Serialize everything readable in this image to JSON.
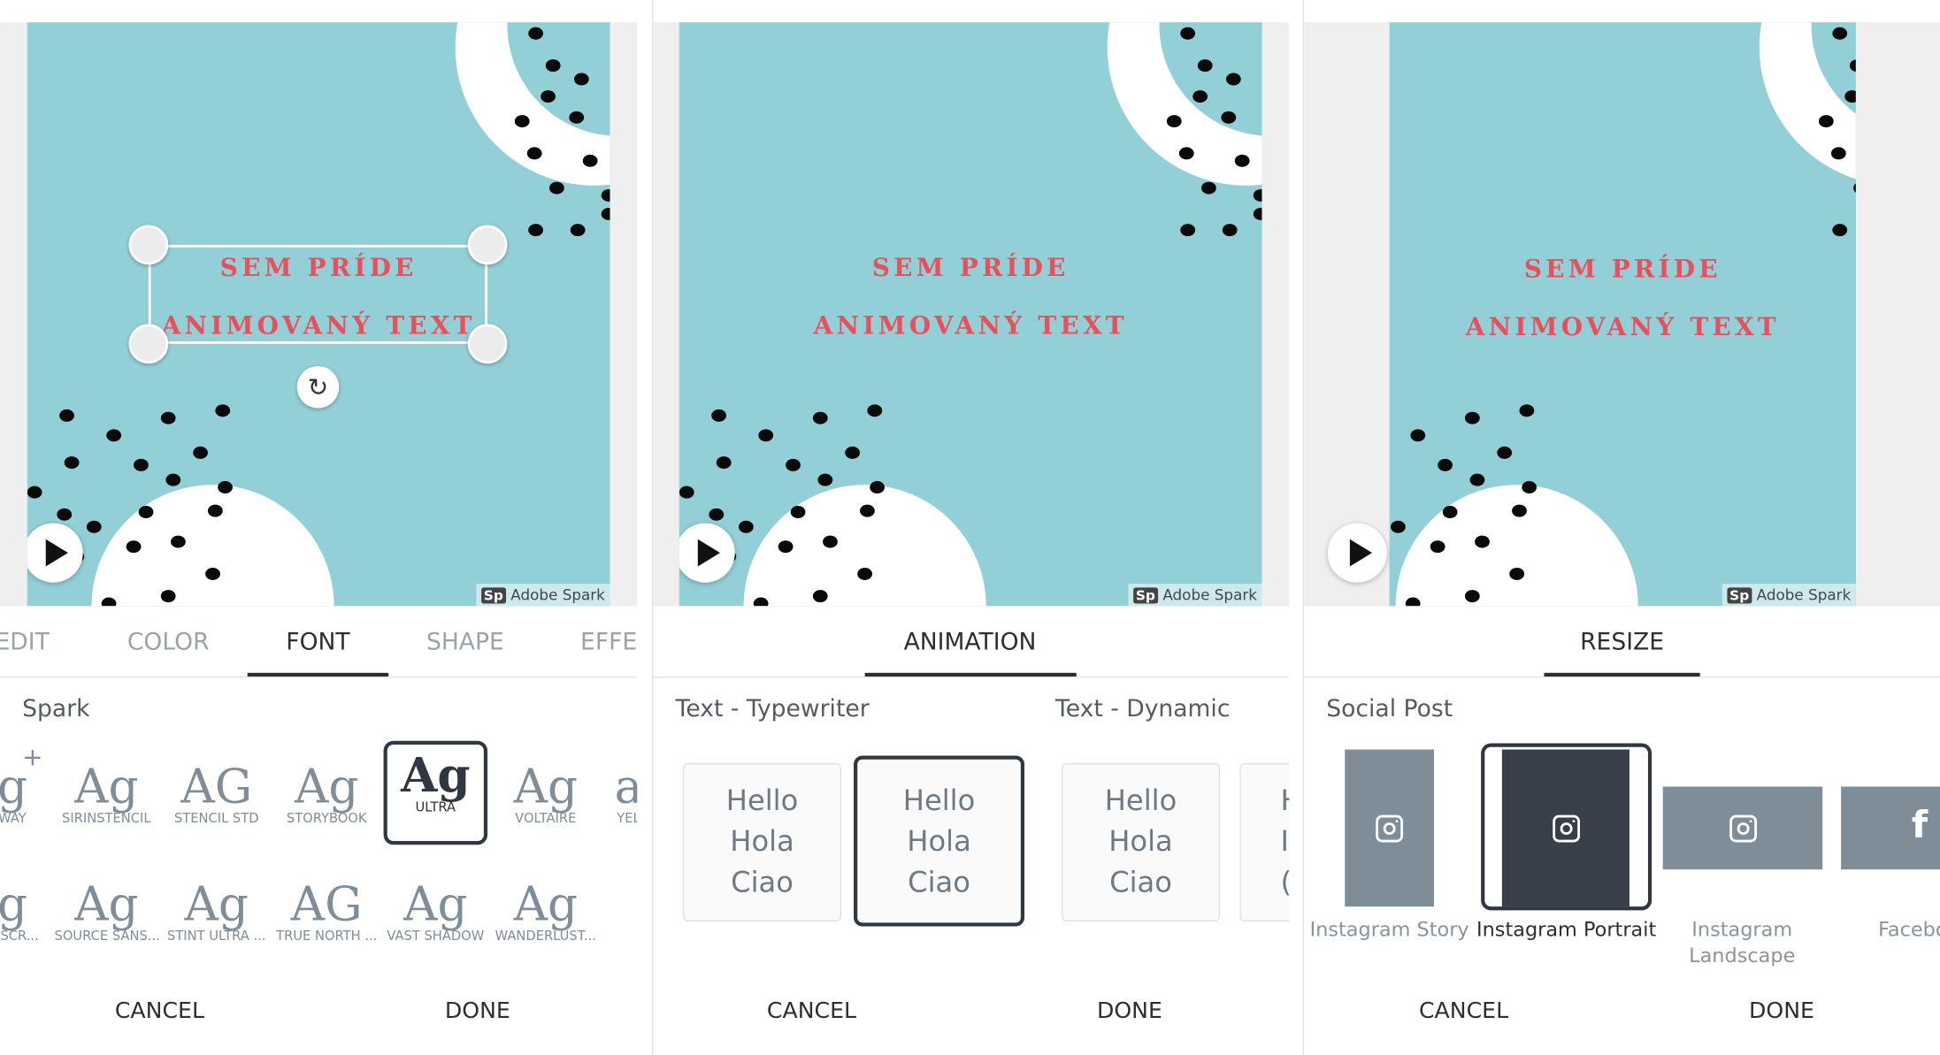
{
  "colors": {
    "canvas_bg": "#92cfd6",
    "text_red": "#e8505b",
    "selected": "#2f3740",
    "thumb_gray": "#7f8d99"
  },
  "design": {
    "line1": "SEM PRÍDE",
    "line2": "ANIMOVANÝ TEXT",
    "watermark_badge": "Sp",
    "watermark": "Adobe Spark",
    "play_icon": "play-icon",
    "rotate_icon": "rotate-icon"
  },
  "font_panel": {
    "tabs": [
      {
        "label": "EDIT"
      },
      {
        "label": "COLOR"
      },
      {
        "label": "FONT",
        "active": true
      },
      {
        "label": "SHAPE"
      },
      {
        "label": "EFFE"
      }
    ],
    "section": "Spark",
    "add_icon": "+",
    "row1": [
      {
        "glyph": "g",
        "label": "WAY"
      },
      {
        "glyph": "Ag",
        "label": "SIRINSTENCIL"
      },
      {
        "glyph": "AG",
        "label": "STENCIL STD"
      },
      {
        "glyph": "Ag",
        "label": "STORYBOOK"
      },
      {
        "glyph": "Ag",
        "label": "ULTRA",
        "selected": true
      },
      {
        "glyph": "Ag",
        "label": "VOLTAIRE"
      },
      {
        "glyph": "a",
        "label": "YEL"
      }
    ],
    "row2": [
      {
        "glyph": "g",
        "label": "O SCR..."
      },
      {
        "glyph": "Ag",
        "label": "SOURCE SANS..."
      },
      {
        "glyph": "Ag",
        "label": "STINT ULTRA ..."
      },
      {
        "glyph": "AG",
        "label": "TRUE NORTH ..."
      },
      {
        "glyph": "Ag",
        "label": "VAST SHADOW"
      },
      {
        "glyph": "Ag",
        "label": "WANDERLUST..."
      }
    ],
    "cancel": "CANCEL",
    "done": "DONE"
  },
  "animation_panel": {
    "tab": "ANIMATION",
    "sections": [
      "Text - Typewriter",
      "Text - Dynamic"
    ],
    "card_lines": [
      "Hello",
      "Hola",
      "Ciao"
    ],
    "partial_card_lines": [
      "H",
      "I",
      "("
    ],
    "cancel": "CANCEL",
    "done": "DONE"
  },
  "resize_panel": {
    "tab": "RESIZE",
    "section": "Social Post",
    "items": [
      {
        "label": "Instagram Story",
        "icon": "instagram-icon"
      },
      {
        "label": "Instagram Portrait",
        "icon": "instagram-icon",
        "selected": true
      },
      {
        "label": "Instagram Landscape",
        "icon": "instagram-icon"
      },
      {
        "label": "Facebo",
        "icon": "facebook-icon"
      }
    ],
    "landscape_lines": [
      "Instagram",
      "Landscape"
    ],
    "facebook_glyph": "f",
    "cancel": "CANCEL",
    "done": "DONE"
  }
}
